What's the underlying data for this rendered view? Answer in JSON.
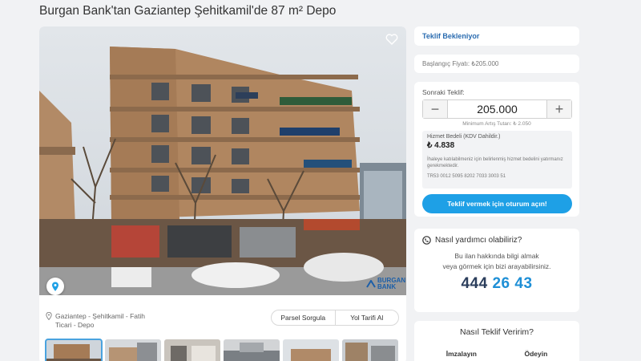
{
  "page": {
    "title": "Burgan Bank'tan Gaziantep Şehitkamil'de 87 m² Depo"
  },
  "gallery": {
    "favorite_icon": "heart-outline-icon",
    "location_pin_icon": "location-pin-icon",
    "watermark": {
      "line1": "BURGAN",
      "line2": "BANK"
    },
    "thumbnail_count": 6
  },
  "location": {
    "icon": "map-marker-icon",
    "text": "Gaziantep - Şehitkamil - Fatih Ticari - Depo"
  },
  "actions": {
    "parcel_query": "Parsel Sorgula",
    "directions": "Yol Tarifi Al"
  },
  "auction": {
    "status": "Teklif Bekleniyor",
    "start_price": "Başlangıç Fiyatı: ₺205.000",
    "next_bid_label": "Sonraki Teklif:",
    "next_bid_value": "205.000",
    "minus": "−",
    "plus": "+",
    "min_increment": "Minimum Artış Tutarı: ₺ 2.050",
    "fee_label": "Hizmet Bedeli (KDV Dahildir.)",
    "fee_value": "₺ 4.838",
    "fee_note": "İhaleye katılabilmeniz için belirlenmiş hizmet bedelini yatırmanız gerekmektedir.",
    "iban": "TR53 0012 5095 8202 7033 3003 51",
    "cta": "Teklif vermek için oturum açın!"
  },
  "help": {
    "title": "Nasıl yardımcı olabiliriz?",
    "line1": "Bu ilan hakkında bilgi almak",
    "line2": "veya görmek için bizi arayabilirsiniz.",
    "phone_part1": "444",
    "phone_part2": "26 43"
  },
  "howto": {
    "title": "Nasıl Teklif Veririm?",
    "step1": "İmzalayın",
    "step2": "Ödeyin"
  },
  "colors": {
    "accent": "#1ea0e6",
    "status": "#2b6cb0",
    "phone_dark": "#2b3e5c"
  }
}
